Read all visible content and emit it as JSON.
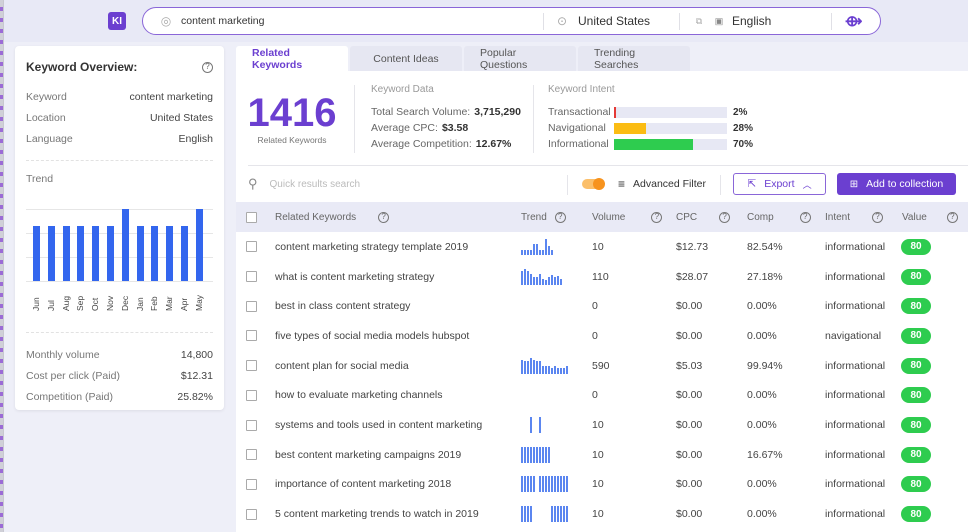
{
  "app": {
    "logo_text": "KI"
  },
  "search": {
    "keyword": "content marketing",
    "location": "United States",
    "language": "English"
  },
  "overview": {
    "title": "Keyword Overview:",
    "rows": [
      {
        "label": "Keyword",
        "value": "content marketing"
      },
      {
        "label": "Location",
        "value": "United States"
      },
      {
        "label": "Language",
        "value": "English"
      }
    ],
    "trend_label": "Trend",
    "trend": {
      "months": [
        "Jun",
        "Jul",
        "Aug",
        "Sep",
        "Oct",
        "Nov",
        "Dec",
        "Jan",
        "Feb",
        "Mar",
        "Apr",
        "May"
      ],
      "values": [
        0.76,
        0.76,
        0.76,
        0.76,
        0.76,
        0.76,
        1.0,
        0.76,
        0.76,
        0.76,
        0.76,
        1.0
      ]
    },
    "stats": [
      {
        "label": "Monthly volume",
        "value": "14,800"
      },
      {
        "label": "Cost per click (Paid)",
        "value": "$12.31"
      },
      {
        "label": "Competition (Paid)",
        "value": "25.82%"
      }
    ]
  },
  "tabs": [
    {
      "label": "Related Keywords",
      "active": true
    },
    {
      "label": "Content Ideas",
      "active": false
    },
    {
      "label": "Popular Questions",
      "active": false
    },
    {
      "label": "Trending Searches",
      "active": false
    }
  ],
  "summary": {
    "count": "1416",
    "count_label": "Related Keywords",
    "keyword_data_title": "Keyword Data",
    "total_search_volume_label": "Total Search Volume:",
    "total_search_volume": "3,715,290",
    "avg_cpc_label": "Average CPC:",
    "avg_cpc": "$3.58",
    "avg_comp_label": "Average Competition:",
    "avg_comp": "12.67%",
    "intent_title": "Keyword Intent",
    "intents": [
      {
        "name": "Transactional",
        "pct_label": "2%",
        "pct": 2,
        "color": "#e53935"
      },
      {
        "name": "Navigational",
        "pct_label": "28%",
        "pct": 28,
        "color": "#fbbc13"
      },
      {
        "name": "Informational",
        "pct_label": "70%",
        "pct": 70,
        "color": "#2ecc4f"
      }
    ]
  },
  "toolbar": {
    "search_placeholder": "Quick results search",
    "advanced_filter": "Advanced Filter",
    "export": "Export",
    "add_to_collection": "Add to collection"
  },
  "table": {
    "headers": {
      "keyword": "Related Keywords",
      "trend": "Trend",
      "volume": "Volume",
      "cpc": "CPC",
      "comp": "Comp",
      "intent": "Intent",
      "value": "Value"
    },
    "rows": [
      {
        "keyword": "content marketing strategy template 2019",
        "trend": [
          2,
          2,
          2,
          2,
          5,
          5,
          2,
          2,
          8,
          4,
          2
        ],
        "volume": "10",
        "cpc": "$12.73",
        "comp": "82.54%",
        "intent": "informational",
        "value": "80"
      },
      {
        "keyword": "what is content marketing strategy",
        "trend": [
          10,
          12,
          10,
          8,
          5,
          5,
          8,
          4,
          3,
          5,
          7,
          5,
          6,
          4
        ],
        "volume": "110",
        "cpc": "$28.07",
        "comp": "27.18%",
        "intent": "informational",
        "value": "80"
      },
      {
        "keyword": "best in class content strategy",
        "trend": [],
        "volume": "0",
        "cpc": "$0.00",
        "comp": "0.00%",
        "intent": "informational",
        "value": "80"
      },
      {
        "keyword": "five types of social media models hubspot",
        "trend": [],
        "volume": "0",
        "cpc": "$0.00",
        "comp": "0.00%",
        "intent": "navigational",
        "value": "80"
      },
      {
        "keyword": "content plan for social media",
        "trend": [
          10,
          9,
          9,
          12,
          10,
          9,
          9,
          5,
          5,
          5,
          4,
          5,
          4,
          4,
          4,
          5
        ],
        "volume": "590",
        "cpc": "$5.03",
        "comp": "99.94%",
        "intent": "informational",
        "value": "80"
      },
      {
        "keyword": "how to evaluate marketing channels",
        "trend": [],
        "volume": "0",
        "cpc": "$0.00",
        "comp": "0.00%",
        "intent": "informational",
        "value": "80"
      },
      {
        "keyword": "systems and tools used in content marketing",
        "trend": [
          0,
          0,
          0,
          10,
          0,
          0,
          10
        ],
        "volume": "10",
        "cpc": "$0.00",
        "comp": "0.00%",
        "intent": "informational",
        "value": "80"
      },
      {
        "keyword": "best content marketing campaigns 2019",
        "trend": [
          10,
          10,
          10,
          10,
          10,
          10,
          10,
          10,
          10,
          10
        ],
        "volume": "10",
        "cpc": "$0.00",
        "comp": "16.67%",
        "intent": "informational",
        "value": "80"
      },
      {
        "keyword": "importance of content marketing 2018",
        "trend": [
          10,
          10,
          10,
          10,
          10,
          0,
          10,
          10,
          10,
          10,
          10,
          10,
          10,
          10,
          10,
          10
        ],
        "volume": "10",
        "cpc": "$0.00",
        "comp": "0.00%",
        "intent": "informational",
        "value": "80"
      },
      {
        "keyword": "5 content marketing trends to watch in 2019",
        "trend": [
          10,
          10,
          10,
          10,
          0,
          0,
          0,
          0,
          0,
          0,
          10,
          10,
          10,
          10,
          10,
          10
        ],
        "volume": "10",
        "cpc": "$0.00",
        "comp": "0.00%",
        "intent": "informational",
        "value": "80"
      }
    ]
  }
}
